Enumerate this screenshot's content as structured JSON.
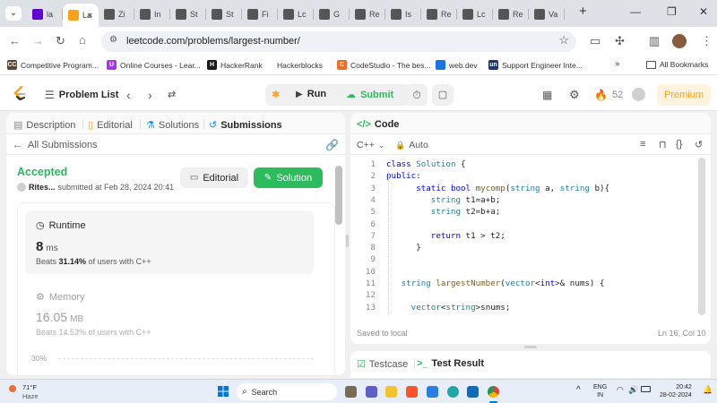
{
  "browser": {
    "tabs": [
      {
        "label": "la",
        "color": "#6001d2"
      },
      {
        "label": "La",
        "color": "#ffa116",
        "active": true
      },
      {
        "label": "Zi",
        "color": "#555555"
      },
      {
        "label": "In",
        "color": "#555555"
      },
      {
        "label": "St",
        "color": "#555555"
      },
      {
        "label": "St",
        "color": "#555555"
      },
      {
        "label": "Fi",
        "color": "#555555"
      },
      {
        "label": "Lc",
        "color": "#555555"
      },
      {
        "label": "G",
        "color": "#555555"
      },
      {
        "label": "Re",
        "color": "#555555"
      },
      {
        "label": "Is",
        "color": "#555555"
      },
      {
        "label": "Re",
        "color": "#555555"
      },
      {
        "label": "Lc",
        "color": "#555555"
      },
      {
        "label": "Re",
        "color": "#555555"
      },
      {
        "label": "Va",
        "color": "#555555"
      }
    ],
    "url": "leetcode.com/problems/largest-number/",
    "bookmarks": [
      {
        "label": "Competitive Program...",
        "icon": "CC",
        "color": "#5b4638"
      },
      {
        "label": "Online Courses - Lear...",
        "icon": "U",
        "color": "#a435f0"
      },
      {
        "label": "HackerRank",
        "icon": "H",
        "color": "#1a1a1a"
      },
      {
        "label": "Hackerblocks",
        "icon": "",
        "color": "#ffffff"
      },
      {
        "label": "CodeStudio - The bes...",
        "icon": "C",
        "color": "#f46b26"
      },
      {
        "label": "web.dev",
        "icon": "",
        "color": "#1a73e8"
      },
      {
        "label": "Support Engineer Inte...",
        "icon": "un",
        "color": "#1f3a68"
      }
    ],
    "all_bookmarks": "All Bookmarks"
  },
  "nav": {
    "problem_list": "Problem List",
    "run": "Run",
    "submit": "Submit",
    "streak": "52",
    "premium": "Premium"
  },
  "left": {
    "tabs": [
      "Description",
      "Editorial",
      "Solutions",
      "Submissions"
    ],
    "all_submissions": "All Submissions",
    "status": "Accepted",
    "user": "Rites...",
    "submitted": "submitted at Feb 28, 2024 20:41",
    "editorial_btn": "Editorial",
    "solution_btn": "Solution",
    "runtime_label": "Runtime",
    "runtime_value": "8",
    "runtime_unit": "ms",
    "runtime_beats_pre": "Beats",
    "runtime_beats_pct": "31.14%",
    "runtime_beats_post": "of users with C++",
    "memory_label": "Memory",
    "memory_value": "16.05",
    "memory_unit": "MB",
    "memory_beats_pre": "Beats",
    "memory_beats_pct": "14.53%",
    "memory_beats_post": "of users with C++",
    "chart_tick": "30%"
  },
  "right": {
    "title": "Code",
    "language": "C++",
    "auto": "Auto",
    "saved": "Saved to local",
    "position": "Ln 16, Col 10",
    "lines": [
      {
        "n": "1",
        "html": "<span class='kw'>class</span> <span class='ty'>Solution</span> {"
      },
      {
        "n": "2",
        "html": "<span class='kw'>public</span>:"
      },
      {
        "n": "3",
        "html": "      <span class='kw'>static</span> <span class='kw'>bool</span> <span class='fn'>mycomp</span>(<span class='ty'>string</span> a, <span class='ty'>string</span> b){"
      },
      {
        "n": "4",
        "html": "         <span class='ty'>string</span> t1=a+b;"
      },
      {
        "n": "5",
        "html": "         <span class='ty'>string</span> t2=b+a;"
      },
      {
        "n": "6",
        "html": ""
      },
      {
        "n": "7",
        "html": "         <span class='kw'>return</span> t1 > t2;"
      },
      {
        "n": "8",
        "html": "      }"
      },
      {
        "n": "9",
        "html": ""
      },
      {
        "n": "10",
        "html": ""
      },
      {
        "n": "11",
        "html": "   <span class='ty'>string</span> <span class='fn'>largestNumber</span>(<span class='ty'>vector</span>&lt;<span class='kw'>int</span>&gt;&amp; nums) {"
      },
      {
        "n": "12",
        "html": ""
      },
      {
        "n": "13",
        "html": "     <span class='ty'>vector</span>&lt;<span class='ty'>string</span>&gt;snums;"
      }
    ]
  },
  "bottom": {
    "testcase": "Testcase",
    "result": "Test Result"
  },
  "taskbar": {
    "weather_temp": "71°F",
    "weather_desc": "Haze",
    "search": "Search",
    "lang1": "ENG",
    "lang2": "IN",
    "time": "20:42",
    "date": "28-02-2024"
  },
  "colors": {
    "accent": "#ffa116",
    "green": "#2cbb5d",
    "accepted": "#2db55d"
  }
}
